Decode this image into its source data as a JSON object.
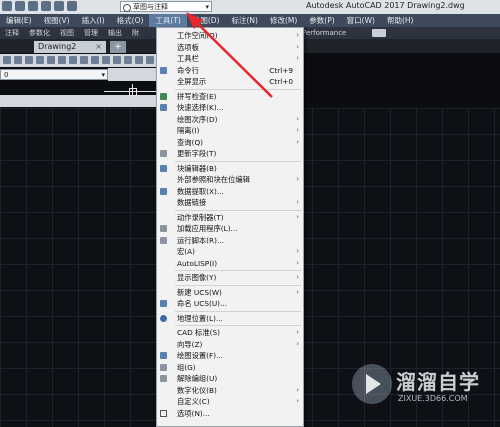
{
  "window": {
    "app_title": "Autodesk AutoCAD 2017    Drawing2.dwg",
    "workspace": "草图与注释"
  },
  "menubar": {
    "items": [
      "编辑(E)",
      "视图(V)",
      "插入(I)",
      "格式(O)",
      "工具(T)",
      "绘图(D)",
      "标注(N)",
      "修改(M)",
      "参数(P)",
      "窗口(W)",
      "帮助(H)"
    ],
    "active_index": 4
  },
  "ribbon": {
    "tabs": [
      "注释",
      "参数化",
      "视图",
      "管理",
      "输出",
      "附"
    ],
    "extra": "Performance"
  },
  "doc_tab": {
    "label": "Drawing2",
    "close": "×",
    "plus": "+"
  },
  "layer_combo": {
    "value": "0"
  },
  "tools_menu": {
    "items": [
      {
        "label": "工作空间(O)",
        "shortcut": "",
        "submenu": true,
        "icon": "none"
      },
      {
        "label": "选项板",
        "shortcut": "",
        "submenu": true,
        "icon": "none"
      },
      {
        "label": "工具栏",
        "shortcut": "",
        "submenu": true,
        "icon": "none"
      },
      {
        "label": "命令行",
        "shortcut": "Ctrl+9",
        "submenu": false,
        "icon": "command-line-icon"
      },
      {
        "label": "全屏显示",
        "shortcut": "Ctrl+0",
        "submenu": false,
        "icon": "none"
      },
      {
        "label": "拼写检查(E)",
        "shortcut": "",
        "submenu": false,
        "icon": "spell-check-icon"
      },
      {
        "label": "快速选择(K)...",
        "shortcut": "",
        "submenu": false,
        "icon": "quick-select-icon"
      },
      {
        "label": "绘图次序(D)",
        "shortcut": "",
        "submenu": true,
        "icon": "none"
      },
      {
        "label": "隔离(I)",
        "shortcut": "",
        "submenu": true,
        "icon": "none"
      },
      {
        "label": "查询(Q)",
        "shortcut": "",
        "submenu": true,
        "icon": "none"
      },
      {
        "label": "更新字段(T)",
        "shortcut": "",
        "submenu": false,
        "icon": "update-field-icon"
      },
      {
        "label": "块编辑器(B)",
        "shortcut": "",
        "submenu": false,
        "icon": "block-editor-icon"
      },
      {
        "label": "外部参照和块在位编辑",
        "shortcut": "",
        "submenu": true,
        "icon": "none"
      },
      {
        "label": "数据提取(X)...",
        "shortcut": "",
        "submenu": false,
        "icon": "data-extract-icon"
      },
      {
        "label": "数据链接",
        "shortcut": "",
        "submenu": true,
        "icon": "none"
      },
      {
        "label": "动作录制器(T)",
        "shortcut": "",
        "submenu": true,
        "icon": "none"
      },
      {
        "label": "加载应用程序(L)...",
        "shortcut": "",
        "submenu": false,
        "icon": "load-app-icon"
      },
      {
        "label": "运行脚本(R)...",
        "shortcut": "",
        "submenu": false,
        "icon": "run-script-icon"
      },
      {
        "label": "宏(A)",
        "shortcut": "",
        "submenu": true,
        "icon": "none"
      },
      {
        "label": "AutoLISP(I)",
        "shortcut": "",
        "submenu": true,
        "icon": "none"
      },
      {
        "label": "显示图像(Y)",
        "shortcut": "",
        "submenu": true,
        "icon": "none"
      },
      {
        "label": "新建 UCS(W)",
        "shortcut": "",
        "submenu": true,
        "icon": "none"
      },
      {
        "label": "命名 UCS(U)...",
        "shortcut": "",
        "submenu": false,
        "icon": "named-ucs-icon"
      },
      {
        "label": "地理位置(L)...",
        "shortcut": "",
        "submenu": false,
        "icon": "geo-location-icon"
      },
      {
        "label": "CAD 标准(S)",
        "shortcut": "",
        "submenu": true,
        "icon": "none"
      },
      {
        "label": "向导(Z)",
        "shortcut": "",
        "submenu": true,
        "icon": "none"
      },
      {
        "label": "绘图设置(F)...",
        "shortcut": "",
        "submenu": false,
        "icon": "drafting-settings-icon"
      },
      {
        "label": "组(G)",
        "shortcut": "",
        "submenu": false,
        "icon": "group-icon"
      },
      {
        "label": "解除编组(U)",
        "shortcut": "",
        "submenu": false,
        "icon": "ungroup-icon"
      },
      {
        "label": "数字化仪(B)",
        "shortcut": "",
        "submenu": true,
        "icon": "none"
      },
      {
        "label": "自定义(C)",
        "shortcut": "",
        "submenu": true,
        "icon": "none"
      },
      {
        "label": "选项(N)...",
        "shortcut": "",
        "submenu": false,
        "icon": "options-icon"
      }
    ]
  },
  "watermark": {
    "name": "溜溜自学",
    "url": "ZIXUE.3D66.COM"
  },
  "colors": {
    "menubar_bg": "#3e4a5b",
    "menu_bg": "#f2f2f2",
    "arrow": "#e8262b",
    "canvas_bg": "#0d1014"
  }
}
